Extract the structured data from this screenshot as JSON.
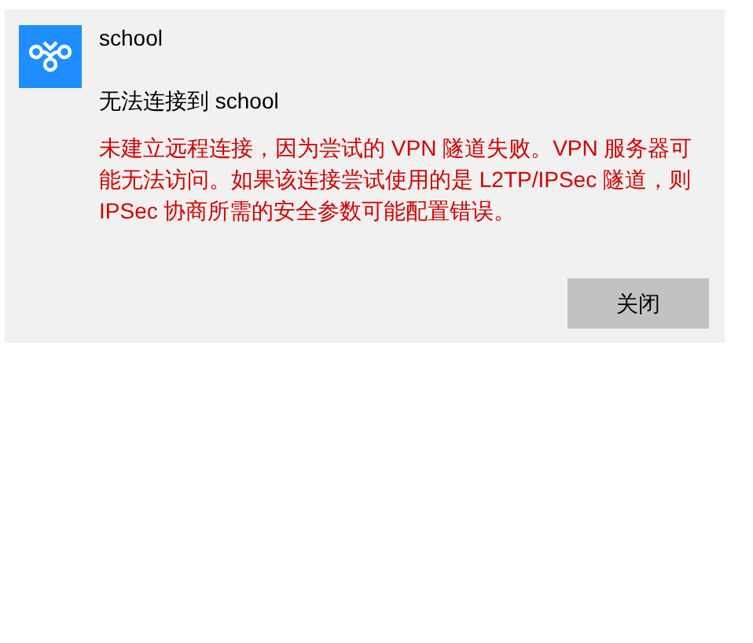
{
  "notification": {
    "app_name": "school",
    "heading": "无法连接到 school",
    "error_message": "未建立远程连接，因为尝试的 VPN 隧道失败。VPN 服务器可能无法访问。如果该连接尝试使用的是 L2TP/IPSec 隧道，则 IPSec 协商所需的安全参数可能配置错误。",
    "buttons": [
      "关闭"
    ]
  }
}
